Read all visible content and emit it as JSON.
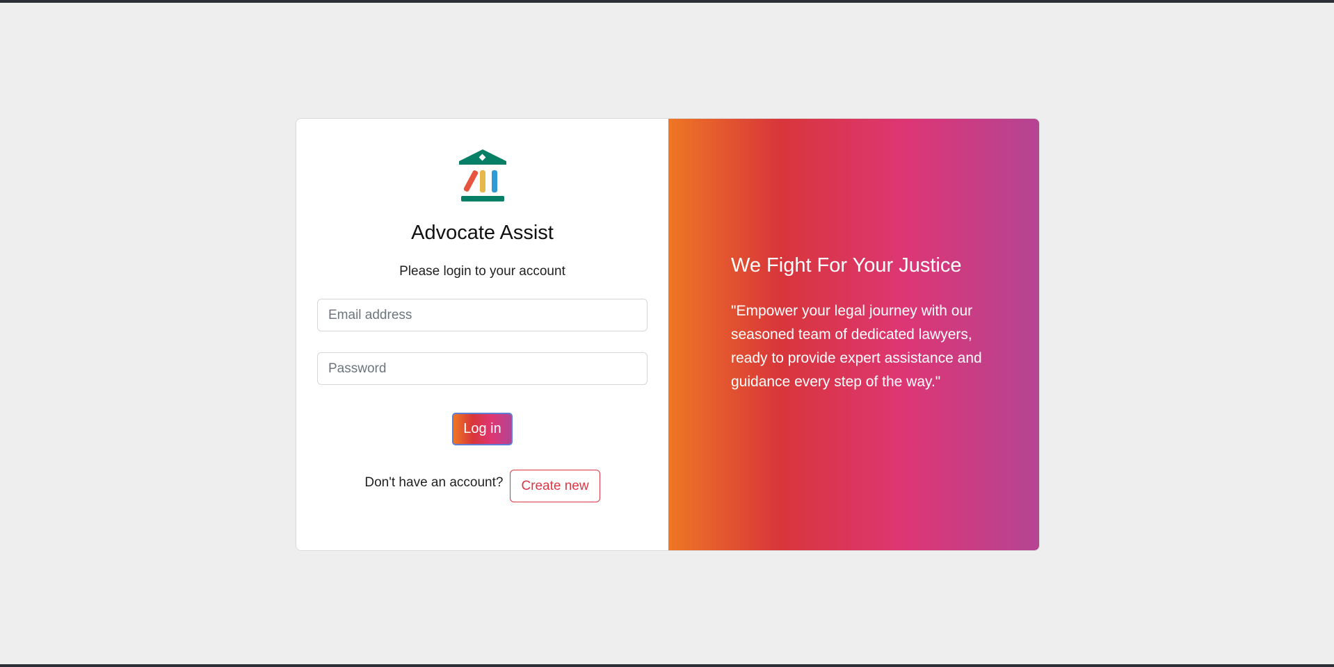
{
  "brand": {
    "title": "Advocate Assist",
    "logo_icon": "courthouse-books-icon",
    "colors": {
      "green": "#077f66",
      "red": "#e8553f",
      "yellow": "#e5b84a",
      "blue": "#2f9bd6"
    }
  },
  "login": {
    "subtitle": "Please login to your account",
    "email_placeholder": "Email address",
    "password_placeholder": "Password",
    "login_label": "Log in",
    "signup_prompt": "Don't have an account?",
    "create_label": "Create new"
  },
  "promo": {
    "headline": "We Fight For Your Justice",
    "quote": "\"Empower your legal journey with our seasoned team of dedicated lawyers, ready to provide expert assistance and guidance every step of the way.\"",
    "gradient_colors": [
      "#ee7724",
      "#d8363a",
      "#dd3675",
      "#b44593"
    ]
  }
}
